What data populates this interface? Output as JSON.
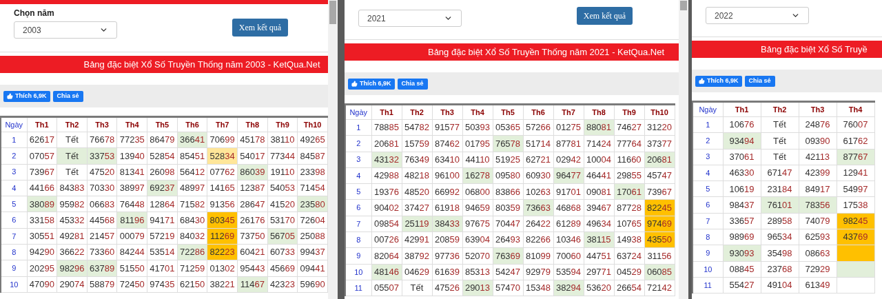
{
  "panels": [
    {
      "label": "Chọn năm",
      "year": "2003",
      "button": "Xem kết quả",
      "banner": "Bảng đặc biệt Xổ Số Truyền Thống năm 2003 - KetQua.Net",
      "like_button": "Thích 6,9K",
      "share_button": "Chia sẻ",
      "table": {
        "day_header": "Ngày",
        "columns": [
          "Th1",
          "Th2",
          "Th3",
          "Th4",
          "Th5",
          "Th6",
          "Th7",
          "Th8",
          "Th9",
          "Th10"
        ],
        "rows": [
          {
            "day": "1",
            "cells": [
              {
                "value": "62617",
                "color": "#ffffff"
              },
              {
                "value": "Tết",
                "color": "#ffffff"
              },
              {
                "value": "76678",
                "color": "#ffffff"
              },
              {
                "value": "77235",
                "color": "#ffffff"
              },
              {
                "value": "86479",
                "color": "#ffffff"
              },
              {
                "value": "36641",
                "color": "#e2efda"
              },
              {
                "value": "70699",
                "color": "#ffffff"
              },
              {
                "value": "45178",
                "color": "#ffffff"
              },
              {
                "value": "38110",
                "color": "#ffffff"
              },
              {
                "value": "49265",
                "color": "#ffffff"
              }
            ]
          },
          {
            "day": "2",
            "cells": [
              {
                "value": "07057",
                "color": "#ffffff"
              },
              {
                "value": "Tết",
                "color": "#e2efda"
              },
              {
                "value": "33753",
                "color": "#e2efda"
              },
              {
                "value": "13940",
                "color": "#ffffff"
              },
              {
                "value": "52854",
                "color": "#ffffff"
              },
              {
                "value": "85451",
                "color": "#ffffff"
              },
              {
                "value": "52834",
                "color": "#ffe699"
              },
              {
                "value": "54017",
                "color": "#ffffff"
              },
              {
                "value": "77344",
                "color": "#ffffff"
              },
              {
                "value": "84587",
                "color": "#ffffff"
              }
            ]
          },
          {
            "day": "3",
            "cells": [
              {
                "value": "73967",
                "color": "#ffffff"
              },
              {
                "value": "Tết",
                "color": "#ffffff"
              },
              {
                "value": "47520",
                "color": "#ffffff"
              },
              {
                "value": "81341",
                "color": "#ffffff"
              },
              {
                "value": "26098",
                "color": "#ffffff"
              },
              {
                "value": "56412",
                "color": "#ffffff"
              },
              {
                "value": "07762",
                "color": "#ffffff"
              },
              {
                "value": "86039",
                "color": "#e2efda"
              },
              {
                "value": "19110",
                "color": "#ffffff"
              },
              {
                "value": "23398",
                "color": "#ffffff"
              }
            ]
          },
          {
            "day": "4",
            "cells": [
              {
                "value": "44166",
                "color": "#ffffff"
              },
              {
                "value": "84383",
                "color": "#ffffff"
              },
              {
                "value": "70330",
                "color": "#ffffff"
              },
              {
                "value": "38997",
                "color": "#ffffff"
              },
              {
                "value": "69237",
                "color": "#e2efda"
              },
              {
                "value": "48997",
                "color": "#ffffff"
              },
              {
                "value": "14165",
                "color": "#ffffff"
              },
              {
                "value": "12387",
                "color": "#ffffff"
              },
              {
                "value": "54053",
                "color": "#ffffff"
              },
              {
                "value": "71454",
                "color": "#ffffff"
              }
            ]
          },
          {
            "day": "5",
            "cells": [
              {
                "value": "38089",
                "color": "#e2efda"
              },
              {
                "value": "95982",
                "color": "#ffffff"
              },
              {
                "value": "06683",
                "color": "#ffffff"
              },
              {
                "value": "76448",
                "color": "#ffffff"
              },
              {
                "value": "12864",
                "color": "#ffffff"
              },
              {
                "value": "71582",
                "color": "#ffffff"
              },
              {
                "value": "91356",
                "color": "#ffffff"
              },
              {
                "value": "28647",
                "color": "#ffffff"
              },
              {
                "value": "41520",
                "color": "#ffffff"
              },
              {
                "value": "23580",
                "color": "#e2efda"
              }
            ]
          },
          {
            "day": "6",
            "cells": [
              {
                "value": "33158",
                "color": "#ffffff"
              },
              {
                "value": "45332",
                "color": "#ffffff"
              },
              {
                "value": "44568",
                "color": "#ffffff"
              },
              {
                "value": "81196",
                "color": "#e2efda"
              },
              {
                "value": "94171",
                "color": "#ffffff"
              },
              {
                "value": "68430",
                "color": "#ffffff"
              },
              {
                "value": "80345",
                "color": "#ffc000"
              },
              {
                "value": "26176",
                "color": "#ffffff"
              },
              {
                "value": "53170",
                "color": "#ffffff"
              },
              {
                "value": "72604",
                "color": "#ffffff"
              }
            ]
          },
          {
            "day": "7",
            "cells": [
              {
                "value": "30551",
                "color": "#ffffff"
              },
              {
                "value": "49281",
                "color": "#ffffff"
              },
              {
                "value": "21457",
                "color": "#ffffff"
              },
              {
                "value": "00079",
                "color": "#ffffff"
              },
              {
                "value": "57219",
                "color": "#ffffff"
              },
              {
                "value": "84032",
                "color": "#ffffff"
              },
              {
                "value": "11269",
                "color": "#ffc000"
              },
              {
                "value": "73750",
                "color": "#ffffff"
              },
              {
                "value": "56705",
                "color": "#e2efda"
              },
              {
                "value": "25088",
                "color": "#ffffff"
              }
            ]
          },
          {
            "day": "8",
            "cells": [
              {
                "value": "94290",
                "color": "#ffffff"
              },
              {
                "value": "36622",
                "color": "#ffffff"
              },
              {
                "value": "73360",
                "color": "#ffffff"
              },
              {
                "value": "84244",
                "color": "#ffffff"
              },
              {
                "value": "53514",
                "color": "#ffffff"
              },
              {
                "value": "72286",
                "color": "#e2efda"
              },
              {
                "value": "82223",
                "color": "#ffc000"
              },
              {
                "value": "60421",
                "color": "#ffffff"
              },
              {
                "value": "60733",
                "color": "#ffffff"
              },
              {
                "value": "99437",
                "color": "#ffffff"
              }
            ]
          },
          {
            "day": "9",
            "cells": [
              {
                "value": "20295",
                "color": "#ffffff"
              },
              {
                "value": "98296",
                "color": "#e2efda"
              },
              {
                "value": "63789",
                "color": "#e2efda"
              },
              {
                "value": "51550",
                "color": "#ffffff"
              },
              {
                "value": "41701",
                "color": "#ffffff"
              },
              {
                "value": "71259",
                "color": "#ffffff"
              },
              {
                "value": "01302",
                "color": "#ffffff"
              },
              {
                "value": "95443",
                "color": "#ffffff"
              },
              {
                "value": "45669",
                "color": "#ffffff"
              },
              {
                "value": "09441",
                "color": "#ffffff"
              }
            ]
          },
          {
            "day": "10",
            "cells": [
              {
                "value": "47090",
                "color": "#ffffff"
              },
              {
                "value": "29074",
                "color": "#ffffff"
              },
              {
                "value": "58879",
                "color": "#ffffff"
              },
              {
                "value": "72450",
                "color": "#ffffff"
              },
              {
                "value": "97435",
                "color": "#ffffff"
              },
              {
                "value": "62150",
                "color": "#ffffff"
              },
              {
                "value": "38221",
                "color": "#ffffff"
              },
              {
                "value": "11467",
                "color": "#e2efda"
              },
              {
                "value": "42323",
                "color": "#ffffff"
              },
              {
                "value": "59690",
                "color": "#ffffff"
              }
            ]
          }
        ]
      }
    },
    {
      "year": "2021",
      "button": "Xem kết quả",
      "banner": "Bảng đặc biệt Xổ Số Truyền Thống năm 2021 - KetQua.Net",
      "like_button": "Thích 6,9K",
      "share_button": "Chia sẻ",
      "table": {
        "day_header": "Ngày",
        "columns": [
          "Th1",
          "Th2",
          "Th3",
          "Th4",
          "Th5",
          "Th6",
          "Th7",
          "Th8",
          "Th9",
          "Th10"
        ],
        "rows": [
          {
            "day": "1",
            "cells": [
              {
                "value": "78885",
                "color": "#ffffff"
              },
              {
                "value": "54782",
                "color": "#ffffff"
              },
              {
                "value": "91577",
                "color": "#ffffff"
              },
              {
                "value": "50393",
                "color": "#ffffff"
              },
              {
                "value": "05365",
                "color": "#ffffff"
              },
              {
                "value": "57266",
                "color": "#ffffff"
              },
              {
                "value": "01275",
                "color": "#ffffff"
              },
              {
                "value": "88081",
                "color": "#e2efda"
              },
              {
                "value": "74627",
                "color": "#ffffff"
              },
              {
                "value": "31220",
                "color": "#ffffff"
              }
            ]
          },
          {
            "day": "2",
            "cells": [
              {
                "value": "20681",
                "color": "#ffffff"
              },
              {
                "value": "15759",
                "color": "#ffffff"
              },
              {
                "value": "87462",
                "color": "#ffffff"
              },
              {
                "value": "01795",
                "color": "#ffffff"
              },
              {
                "value": "76578",
                "color": "#e2efda"
              },
              {
                "value": "51714",
                "color": "#ffffff"
              },
              {
                "value": "87781",
                "color": "#ffffff"
              },
              {
                "value": "71424",
                "color": "#ffffff"
              },
              {
                "value": "77764",
                "color": "#ffffff"
              },
              {
                "value": "37377",
                "color": "#ffffff"
              }
            ]
          },
          {
            "day": "3",
            "cells": [
              {
                "value": "43132",
                "color": "#e2efda"
              },
              {
                "value": "76349",
                "color": "#ffffff"
              },
              {
                "value": "63410",
                "color": "#ffffff"
              },
              {
                "value": "44110",
                "color": "#ffffff"
              },
              {
                "value": "51925",
                "color": "#ffffff"
              },
              {
                "value": "62721",
                "color": "#ffffff"
              },
              {
                "value": "02942",
                "color": "#ffffff"
              },
              {
                "value": "10004",
                "color": "#ffffff"
              },
              {
                "value": "11660",
                "color": "#ffffff"
              },
              {
                "value": "20681",
                "color": "#e2efda"
              }
            ]
          },
          {
            "day": "4",
            "cells": [
              {
                "value": "42988",
                "color": "#ffffff"
              },
              {
                "value": "48218",
                "color": "#ffffff"
              },
              {
                "value": "96100",
                "color": "#ffffff"
              },
              {
                "value": "16278",
                "color": "#e2efda"
              },
              {
                "value": "09580",
                "color": "#ffffff"
              },
              {
                "value": "60930",
                "color": "#ffffff"
              },
              {
                "value": "96477",
                "color": "#e2efda"
              },
              {
                "value": "46441",
                "color": "#ffffff"
              },
              {
                "value": "29855",
                "color": "#ffffff"
              },
              {
                "value": "45747",
                "color": "#ffffff"
              }
            ]
          },
          {
            "day": "5",
            "cells": [
              {
                "value": "19376",
                "color": "#ffffff"
              },
              {
                "value": "48520",
                "color": "#ffffff"
              },
              {
                "value": "66992",
                "color": "#ffffff"
              },
              {
                "value": "06800",
                "color": "#ffffff"
              },
              {
                "value": "83866",
                "color": "#ffffff"
              },
              {
                "value": "10263",
                "color": "#ffffff"
              },
              {
                "value": "91701",
                "color": "#ffffff"
              },
              {
                "value": "09081",
                "color": "#ffffff"
              },
              {
                "value": "17061",
                "color": "#e2efda"
              },
              {
                "value": "73967",
                "color": "#ffffff"
              }
            ]
          },
          {
            "day": "6",
            "cells": [
              {
                "value": "90402",
                "color": "#ffffff"
              },
              {
                "value": "37427",
                "color": "#ffffff"
              },
              {
                "value": "61918",
                "color": "#ffffff"
              },
              {
                "value": "94659",
                "color": "#ffffff"
              },
              {
                "value": "80359",
                "color": "#ffffff"
              },
              {
                "value": "73663",
                "color": "#e2efda"
              },
              {
                "value": "46868",
                "color": "#ffffff"
              },
              {
                "value": "39467",
                "color": "#ffffff"
              },
              {
                "value": "87728",
                "color": "#ffffff"
              },
              {
                "value": "82245",
                "color": "#ffc000"
              }
            ]
          },
          {
            "day": "7",
            "cells": [
              {
                "value": "09854",
                "color": "#ffffff"
              },
              {
                "value": "25119",
                "color": "#e2efda"
              },
              {
                "value": "38433",
                "color": "#e2efda"
              },
              {
                "value": "97675",
                "color": "#ffffff"
              },
              {
                "value": "70447",
                "color": "#ffffff"
              },
              {
                "value": "26422",
                "color": "#ffffff"
              },
              {
                "value": "61289",
                "color": "#ffffff"
              },
              {
                "value": "49634",
                "color": "#ffffff"
              },
              {
                "value": "10765",
                "color": "#ffffff"
              },
              {
                "value": "97469",
                "color": "#ffc000"
              }
            ]
          },
          {
            "day": "8",
            "cells": [
              {
                "value": "00726",
                "color": "#ffffff"
              },
              {
                "value": "42991",
                "color": "#ffffff"
              },
              {
                "value": "20859",
                "color": "#ffffff"
              },
              {
                "value": "63904",
                "color": "#ffffff"
              },
              {
                "value": "26493",
                "color": "#ffffff"
              },
              {
                "value": "82266",
                "color": "#ffffff"
              },
              {
                "value": "10346",
                "color": "#ffffff"
              },
              {
                "value": "38115",
                "color": "#e2efda"
              },
              {
                "value": "14938",
                "color": "#ffffff"
              },
              {
                "value": "43550",
                "color": "#ffc000"
              }
            ]
          },
          {
            "day": "9",
            "cells": [
              {
                "value": "82064",
                "color": "#ffffff"
              },
              {
                "value": "38792",
                "color": "#ffffff"
              },
              {
                "value": "97736",
                "color": "#ffffff"
              },
              {
                "value": "52070",
                "color": "#ffffff"
              },
              {
                "value": "76369",
                "color": "#e2efda"
              },
              {
                "value": "81099",
                "color": "#ffffff"
              },
              {
                "value": "70060",
                "color": "#ffffff"
              },
              {
                "value": "44751",
                "color": "#ffffff"
              },
              {
                "value": "63724",
                "color": "#ffffff"
              },
              {
                "value": "31156",
                "color": "#ffffff"
              }
            ]
          },
          {
            "day": "10",
            "cells": [
              {
                "value": "48146",
                "color": "#e2efda"
              },
              {
                "value": "04629",
                "color": "#ffffff"
              },
              {
                "value": "61639",
                "color": "#ffffff"
              },
              {
                "value": "85313",
                "color": "#ffffff"
              },
              {
                "value": "54247",
                "color": "#ffffff"
              },
              {
                "value": "92979",
                "color": "#ffffff"
              },
              {
                "value": "53594",
                "color": "#ffffff"
              },
              {
                "value": "29771",
                "color": "#ffffff"
              },
              {
                "value": "04529",
                "color": "#ffffff"
              },
              {
                "value": "06085",
                "color": "#e2efda"
              }
            ]
          },
          {
            "day": "11",
            "cells": [
              {
                "value": "05507",
                "color": "#ffffff"
              },
              {
                "value": "Tết",
                "color": "#ffffff"
              },
              {
                "value": "47526",
                "color": "#ffffff"
              },
              {
                "value": "29013",
                "color": "#e2efda"
              },
              {
                "value": "57470",
                "color": "#ffffff"
              },
              {
                "value": "15348",
                "color": "#ffffff"
              },
              {
                "value": "38294",
                "color": "#e2efda"
              },
              {
                "value": "53620",
                "color": "#ffffff"
              },
              {
                "value": "26654",
                "color": "#ffffff"
              },
              {
                "value": "72142",
                "color": "#ffffff"
              }
            ]
          }
        ]
      }
    },
    {
      "year": "2022",
      "banner": "Bảng đặc biệt Xổ Số Truyề",
      "like_button": "Thích 6,9K",
      "share_button": "Chia sẻ",
      "table": {
        "day_header": "Ngày",
        "columns": [
          "Th1",
          "Th2",
          "Th3",
          "Th4"
        ],
        "rows": [
          {
            "day": "1",
            "cells": [
              {
                "value": "10676",
                "color": "#ffffff"
              },
              {
                "value": "Tết",
                "color": "#ffffff"
              },
              {
                "value": "24876",
                "color": "#ffffff"
              },
              {
                "value": "76007",
                "color": "#ffffff"
              }
            ]
          },
          {
            "day": "2",
            "cells": [
              {
                "value": "93494",
                "color": "#e2efda"
              },
              {
                "value": "Tết",
                "color": "#ffffff"
              },
              {
                "value": "09390",
                "color": "#ffffff"
              },
              {
                "value": "61762",
                "color": "#ffffff"
              }
            ]
          },
          {
            "day": "3",
            "cells": [
              {
                "value": "37061",
                "color": "#ffffff"
              },
              {
                "value": "Tết",
                "color": "#ffffff"
              },
              {
                "value": "42113",
                "color": "#ffffff"
              },
              {
                "value": "87767",
                "color": "#e2efda"
              }
            ]
          },
          {
            "day": "4",
            "cells": [
              {
                "value": "46330",
                "color": "#ffffff"
              },
              {
                "value": "67147",
                "color": "#ffffff"
              },
              {
                "value": "42399",
                "color": "#ffffff"
              },
              {
                "value": "12941",
                "color": "#ffffff"
              }
            ]
          },
          {
            "day": "5",
            "cells": [
              {
                "value": "10619",
                "color": "#ffffff"
              },
              {
                "value": "23184",
                "color": "#ffffff"
              },
              {
                "value": "84917",
                "color": "#ffffff"
              },
              {
                "value": "54997",
                "color": "#ffffff"
              }
            ]
          },
          {
            "day": "6",
            "cells": [
              {
                "value": "98437",
                "color": "#ffffff"
              },
              {
                "value": "76101",
                "color": "#e2efda"
              },
              {
                "value": "78356",
                "color": "#e2efda"
              },
              {
                "value": "17538",
                "color": "#ffffff"
              }
            ]
          },
          {
            "day": "7",
            "cells": [
              {
                "value": "33657",
                "color": "#ffffff"
              },
              {
                "value": "28958",
                "color": "#ffffff"
              },
              {
                "value": "74079",
                "color": "#ffffff"
              },
              {
                "value": "98245",
                "color": "#ffc000"
              }
            ]
          },
          {
            "day": "8",
            "cells": [
              {
                "value": "98969",
                "color": "#ffffff"
              },
              {
                "value": "96534",
                "color": "#ffffff"
              },
              {
                "value": "62593",
                "color": "#ffffff"
              },
              {
                "value": "43769",
                "color": "#ffc000"
              }
            ]
          },
          {
            "day": "9",
            "cells": [
              {
                "value": "93093",
                "color": "#e2efda"
              },
              {
                "value": "35498",
                "color": "#ffffff"
              },
              {
                "value": "08663",
                "color": "#ffffff"
              },
              {
                "color": "#ffc000"
              }
            ]
          },
          {
            "day": "10",
            "cells": [
              {
                "value": "08845",
                "color": "#ffffff"
              },
              {
                "value": "23768",
                "color": "#ffffff"
              },
              {
                "value": "72929",
                "color": "#ffffff"
              },
              {
                "color": "#e2efda"
              }
            ]
          },
          {
            "day": "11",
            "cells": [
              {
                "value": "55427",
                "color": "#ffffff"
              },
              {
                "value": "49104",
                "color": "#ffffff"
              },
              {
                "value": "61349",
                "color": "#ffffff"
              },
              {
                "color": "#ffffff"
              }
            ]
          }
        ]
      }
    }
  ]
}
